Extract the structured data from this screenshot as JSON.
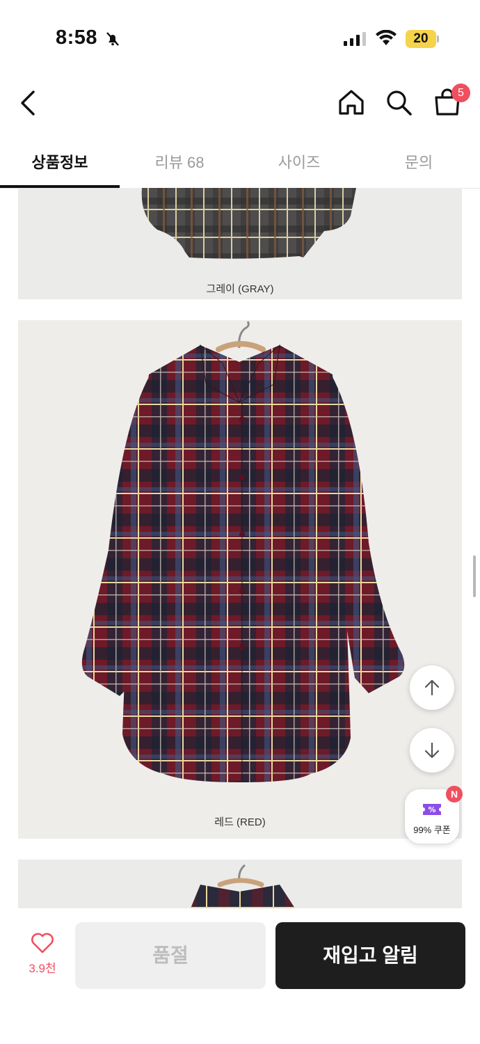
{
  "status_bar": {
    "time": "8:58",
    "battery": "20"
  },
  "header": {
    "cart_count": "5"
  },
  "tabs": [
    {
      "label": "상품정보",
      "active": true
    },
    {
      "label": "리뷰 68",
      "active": false
    },
    {
      "label": "사이즈",
      "active": false
    },
    {
      "label": "문의",
      "active": false
    }
  ],
  "images": [
    {
      "caption": "그레이 (GRAY)",
      "color": "#5a5756"
    },
    {
      "caption": "레드 (RED)",
      "color": "#7a1f2e"
    },
    {
      "caption": "",
      "color": "#2b2a3a"
    }
  ],
  "floating": {
    "coupon_label": "99% 쿠폰",
    "coupon_badge": "N"
  },
  "bottom_bar": {
    "like_count": "3.9천",
    "soldout_label": "품절",
    "restock_label": "재입고 알림"
  },
  "colors": {
    "accent": "#f04f5f",
    "dark": "#1e1e1e",
    "coupon": "#8b4de8"
  }
}
